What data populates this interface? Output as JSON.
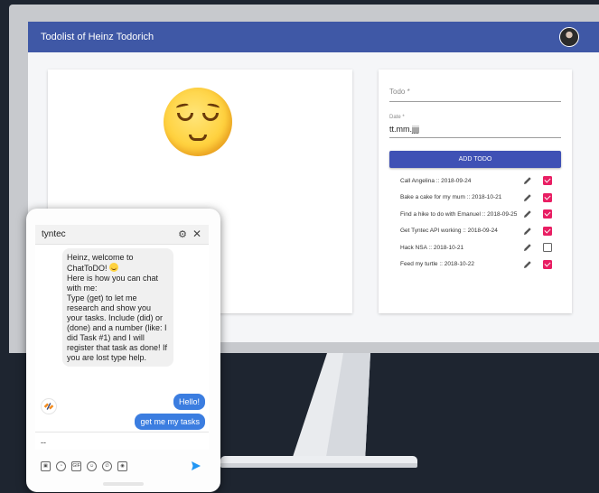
{
  "app": {
    "title": "Todolist of Heinz Todorich"
  },
  "form": {
    "todo_label": "Todo",
    "required_mark": " *",
    "date_label": "Date *",
    "date_value": "tt.mm.jjjj",
    "add_button": "ADD TODO"
  },
  "todos": [
    {
      "text": "Call Angelina :: 2018-09-24",
      "done": true
    },
    {
      "text": "Bake a cake for my mum :: 2018-10-21",
      "done": true
    },
    {
      "text": "Find a hike to do with Emanuel :: 2018-09-25",
      "done": true
    },
    {
      "text": "Get Tyntec API working :: 2018-09-24",
      "done": true
    },
    {
      "text": "Hack NSA :: 2018-10-21",
      "done": false
    },
    {
      "text": "Feed my turtle :: 2018-10-22",
      "done": true
    }
  ],
  "chat": {
    "title": "tyntec",
    "bot_message": {
      "line1": "Heinz, welcome to ChatToDO!",
      "line2": "Here is how you can chat with me:",
      "line3": "Type (get) to let me research and show you your tasks. Include (did) or (done) and a number (like: I did Task #1) and I will register that task as done! If you are lost type help."
    },
    "user_messages": [
      "Hello!",
      "get me my tasks"
    ],
    "input_value": "--",
    "tool_labels": {
      "gif": "GIF"
    }
  },
  "icons": {
    "avatar": "user-avatar",
    "edit": "pencil-icon",
    "settings": "gear-icon",
    "close": "close-icon",
    "send": "send-icon"
  },
  "colors": {
    "appbar": "#3f58a6",
    "button": "#3f51b5",
    "checkbox_checked": "#e91e63",
    "user_bubble": "#3b7de0",
    "send_icon": "#2196f3"
  }
}
